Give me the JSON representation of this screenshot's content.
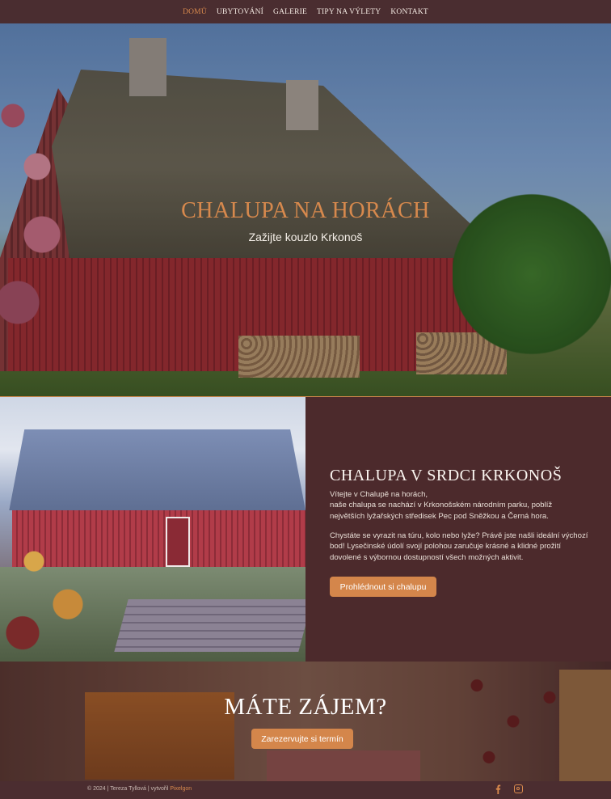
{
  "nav": {
    "items": [
      {
        "label": "DOMŮ",
        "active": true
      },
      {
        "label": "UBYTOVÁNÍ",
        "active": false
      },
      {
        "label": "GALERIE",
        "active": false
      },
      {
        "label": "TIPY NA VÝLETY",
        "active": false
      },
      {
        "label": "KONTAKT",
        "active": false
      }
    ]
  },
  "hero": {
    "title": "CHALUPA NA HORÁCH",
    "subtitle": "Zažijte kouzlo Krkonoš",
    "scroll_icon": "chevron-down-icon"
  },
  "about": {
    "heading": "CHALUPA V SRDCI KRKONOŠ",
    "paragraph1_line1": "Vítejte v Chalupě na horách,",
    "paragraph1_line2": "naše chalupa se nachází v Krkonošském národním parku, poblíž největších lyžařských středisek Pec pod Sněžkou a Černá hora.",
    "paragraph2": "Chystáte se vyrazit na túru, kolo nebo lyže? Právě jste našli ideální výchozí bod! Lysečinské údolí svojí polohou zaručuje krásné a klidné prožití dovolené s výbornou dostupností všech možných aktivit.",
    "button_label": "Prohlédnout si chalupu"
  },
  "cta": {
    "heading": "MÁTE ZÁJEM?",
    "button_label": "Zarezervujte si termín"
  },
  "footer": {
    "copyright": "© 2024 | Tereza Tyllová | vytvořil ",
    "credit": "Pixelgon",
    "icons": [
      "facebook-icon",
      "instagram-icon"
    ]
  },
  "colors": {
    "accent": "#d4864b",
    "background": "#4a2a2c",
    "text_light": "#fbf6f1"
  }
}
